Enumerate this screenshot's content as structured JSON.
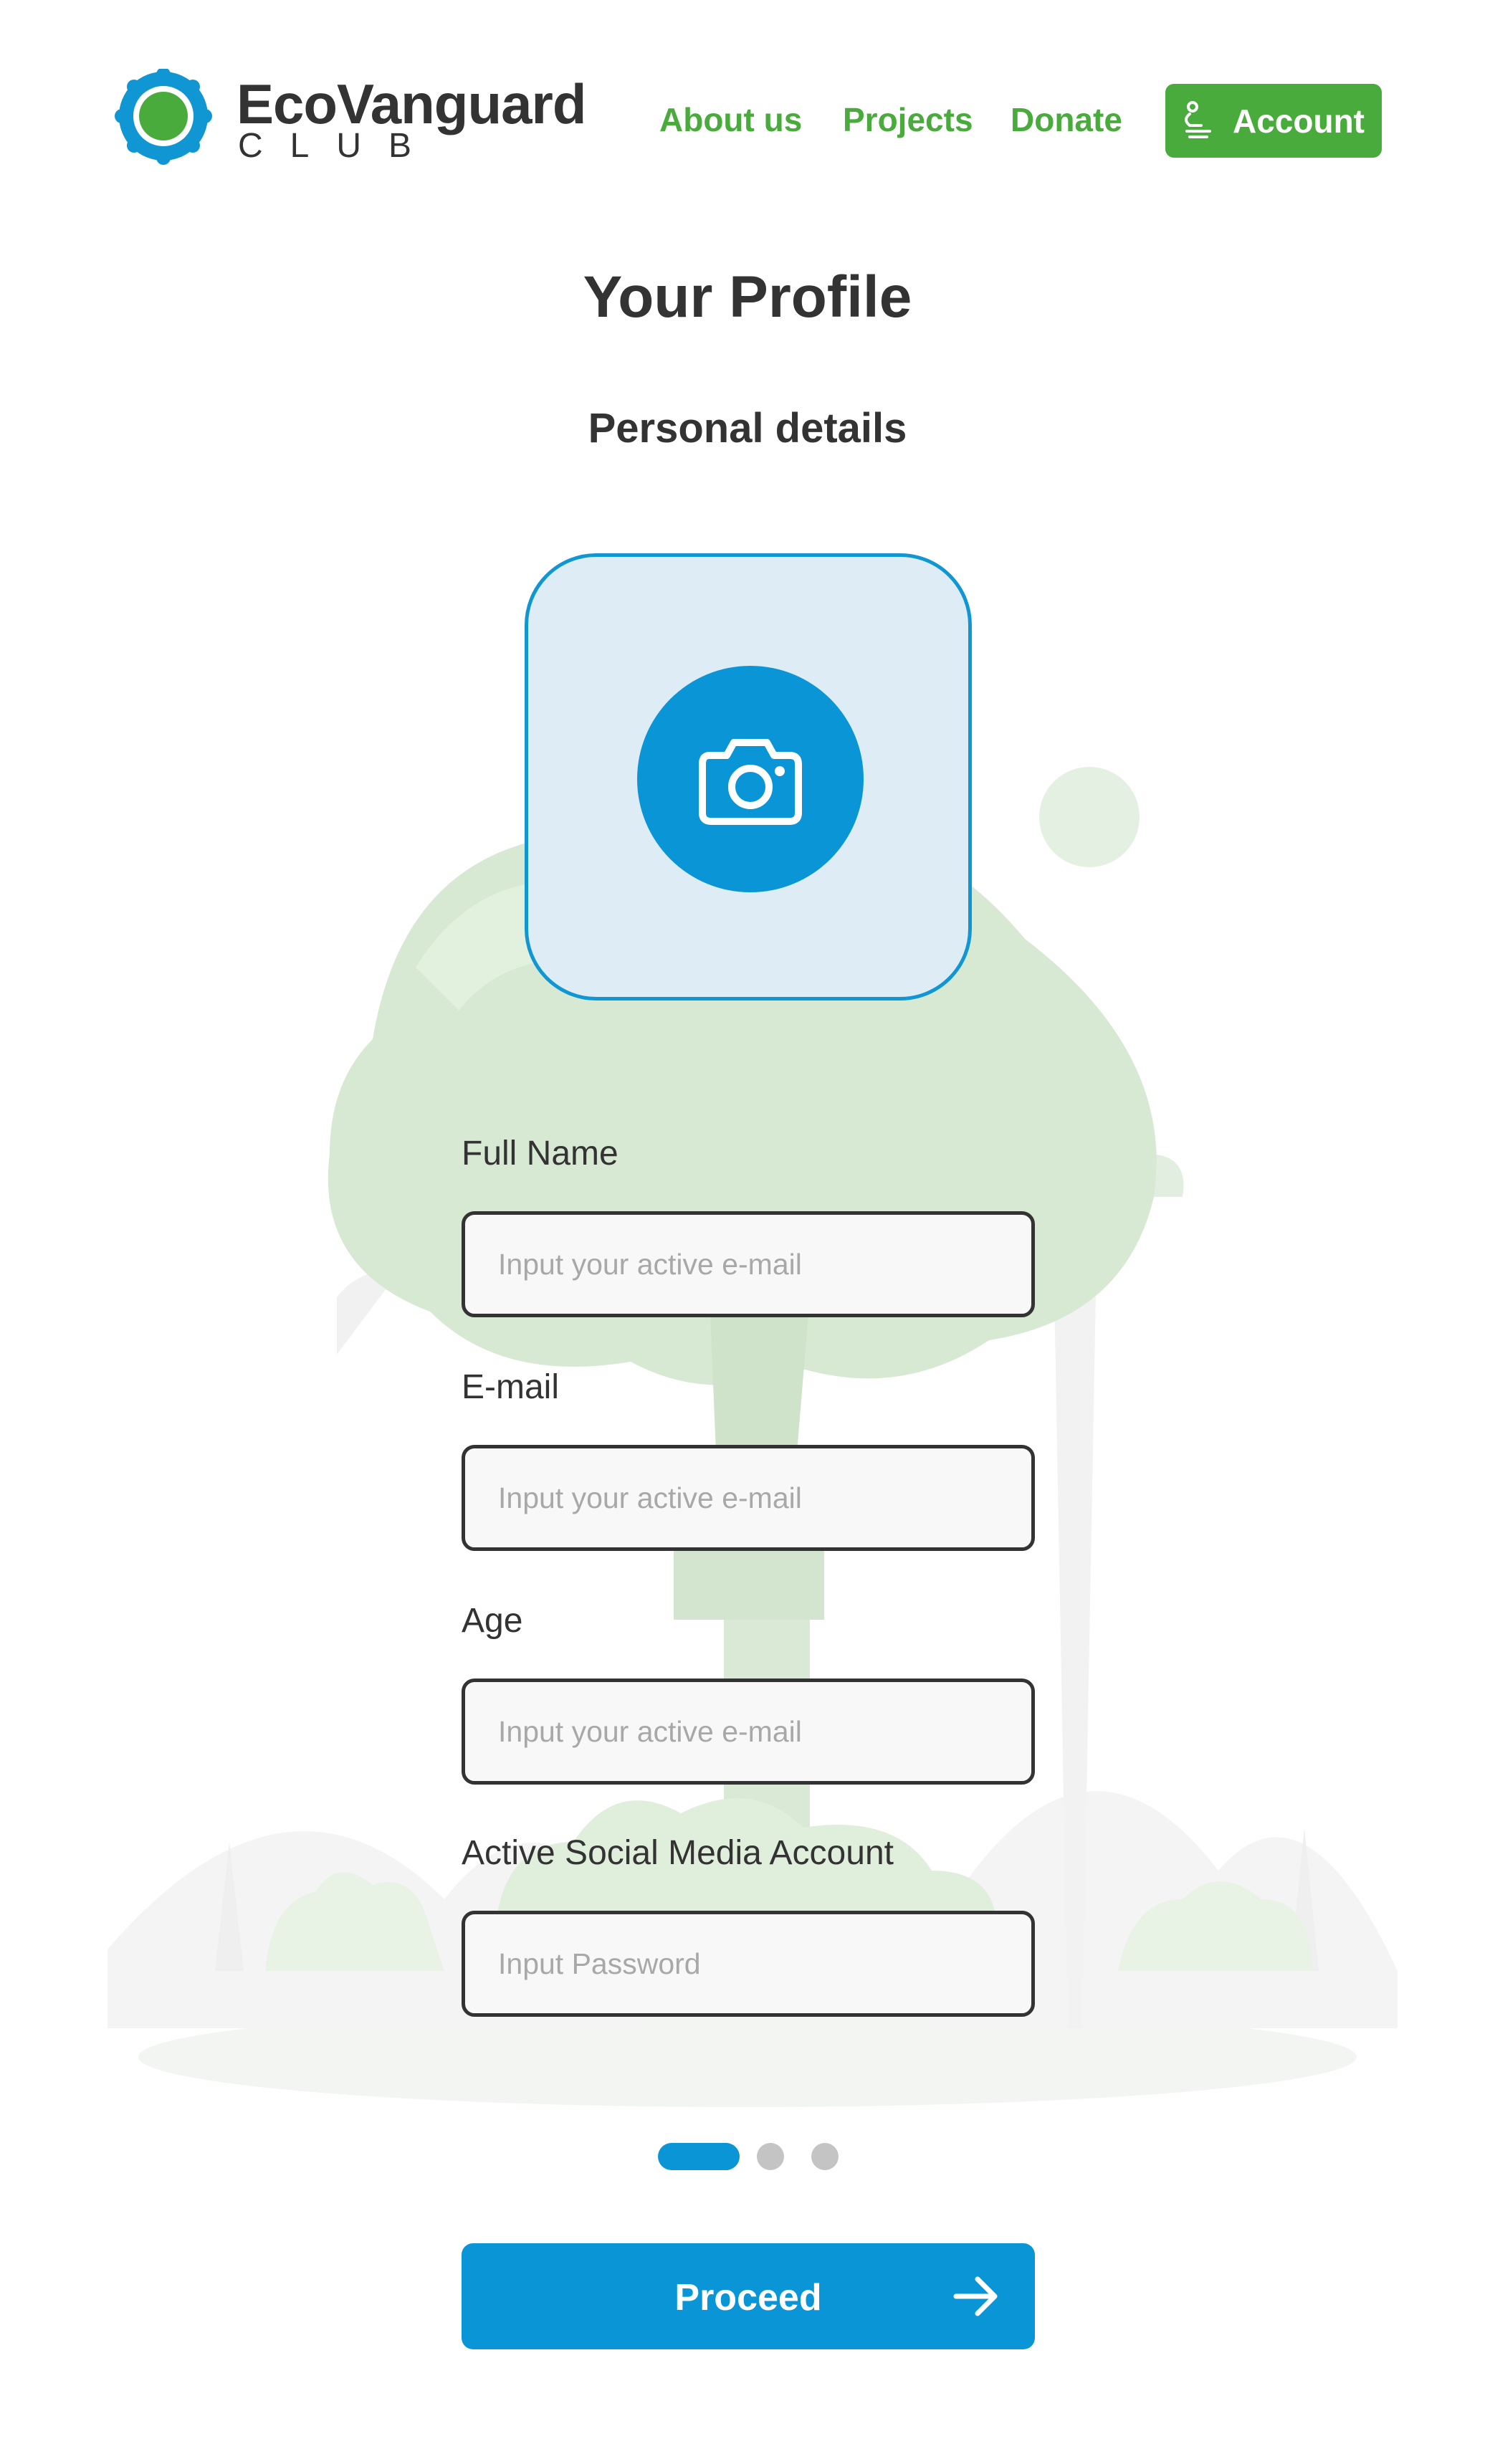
{
  "header": {
    "brand_name": "EcoVanguard",
    "brand_sub": "CLUB",
    "nav": {
      "about": "About us",
      "projects": "Projects",
      "donate": "Donate"
    },
    "account_label": "Account"
  },
  "page": {
    "title": "Your Profile",
    "section_title": "Personal details"
  },
  "photo_upload": {
    "icon": "camera-icon"
  },
  "form": {
    "full_name": {
      "label": "Full Name",
      "placeholder": "Input your active e-mail"
    },
    "email": {
      "label": "E-mail",
      "placeholder": "Input your active e-mail"
    },
    "age": {
      "label": "Age",
      "placeholder": "Input your active e-mail"
    },
    "social": {
      "label": "Active Social Media Account",
      "placeholder": "Input Password"
    }
  },
  "pagination": {
    "current_step": 1,
    "total_steps": 3
  },
  "proceed_label": "Proceed",
  "colors": {
    "brand_green": "#4aab3d",
    "brand_blue": "#0a96d6",
    "text_dark": "#333333",
    "upload_bg": "#ddecf5"
  }
}
